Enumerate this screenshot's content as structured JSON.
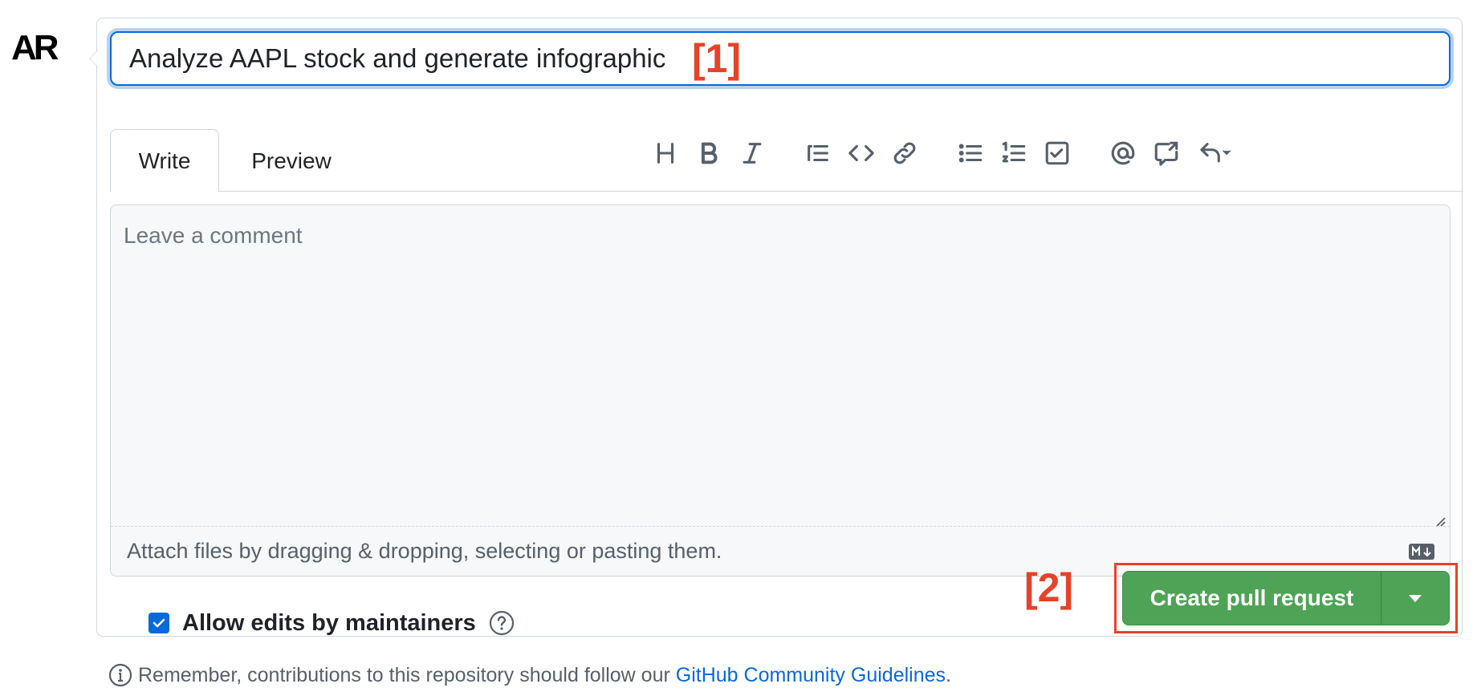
{
  "avatar": {
    "initials": "AR"
  },
  "pr_form": {
    "title_value": "Analyze AAPL stock and generate infographic",
    "annotation_1": "[1]",
    "tabs": [
      {
        "label": "Write",
        "active": true
      },
      {
        "label": "Preview",
        "active": false
      }
    ],
    "toolbar_icons": [
      "heading-icon",
      "bold-icon",
      "italic-icon",
      "quote-icon",
      "code-icon",
      "link-icon",
      "unordered-list-icon",
      "ordered-list-icon",
      "tasklist-icon",
      "mention-icon",
      "cross-reference-icon",
      "reply-icon"
    ],
    "comment": {
      "placeholder": "Leave a comment",
      "attach_hint": "Attach files by dragging & dropping, selecting or pasting them.",
      "markdown_icon": "markdown-icon"
    },
    "allow_edits": {
      "label": "Allow edits by maintainers",
      "checked": true
    },
    "annotation_2": "[2]",
    "submit": {
      "label": "Create pull request"
    }
  },
  "footer": {
    "text_before": "Remember, contributions to this repository should follow our ",
    "link": "GitHub Community Guidelines",
    "text_after": "."
  },
  "colors": {
    "accent_blue": "#0969da",
    "primary_green": "#4fa356",
    "annotation_red": "#e8412a"
  }
}
